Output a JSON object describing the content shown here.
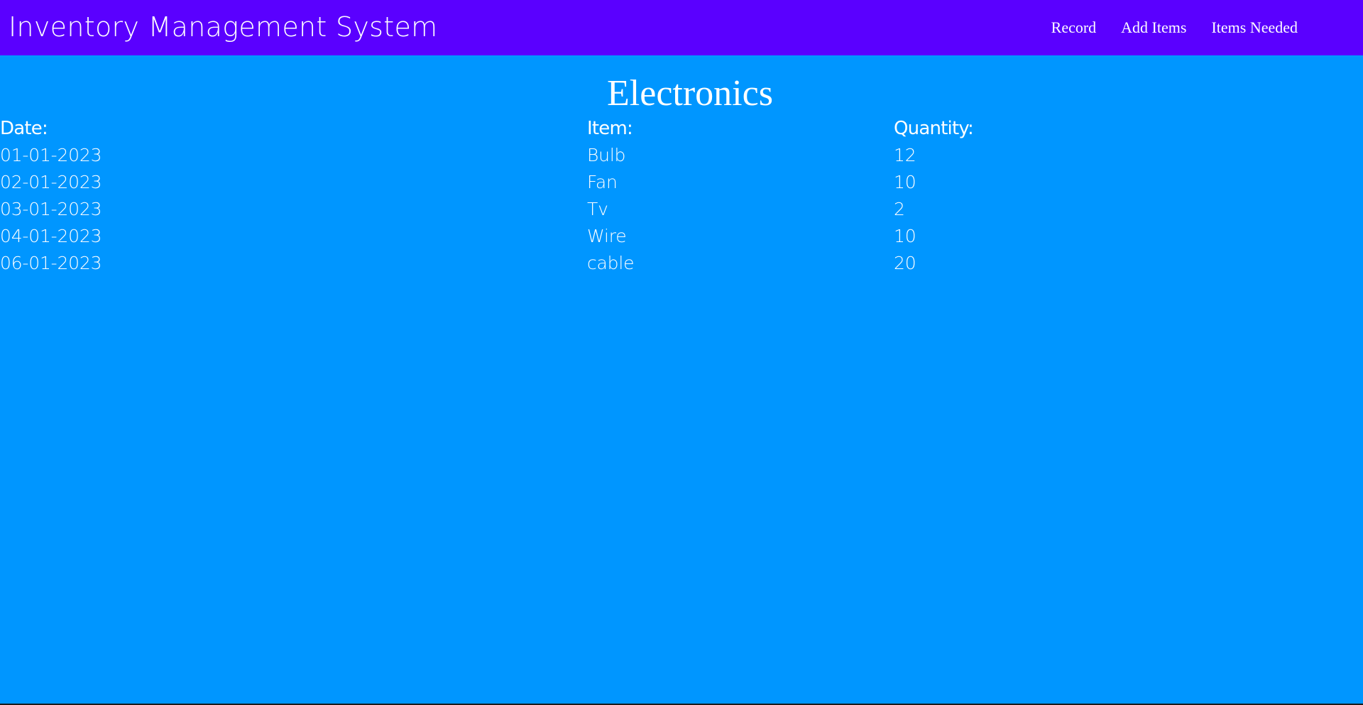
{
  "header": {
    "title": "Inventory Management System",
    "nav": [
      {
        "label": "Record"
      },
      {
        "label": "Add Items"
      },
      {
        "label": "Items Needed"
      }
    ]
  },
  "main": {
    "section_title": "Electronics",
    "columns": {
      "date": "Date:",
      "item": "Item:",
      "quantity": "Quantity:"
    },
    "rows": [
      {
        "date": "01-01-2023",
        "item": "Bulb",
        "quantity": "12"
      },
      {
        "date": "02-01-2023",
        "item": "Fan",
        "quantity": "10"
      },
      {
        "date": "03-01-2023",
        "item": "Tv",
        "quantity": "2"
      },
      {
        "date": "04-01-2023",
        "item": "Wire",
        "quantity": "10"
      },
      {
        "date": "06-01-2023",
        "item": "cable",
        "quantity": "20"
      }
    ]
  },
  "colors": {
    "header_bg": "#5a00ff",
    "main_bg": "#0096ff",
    "text": "#ffffff"
  }
}
